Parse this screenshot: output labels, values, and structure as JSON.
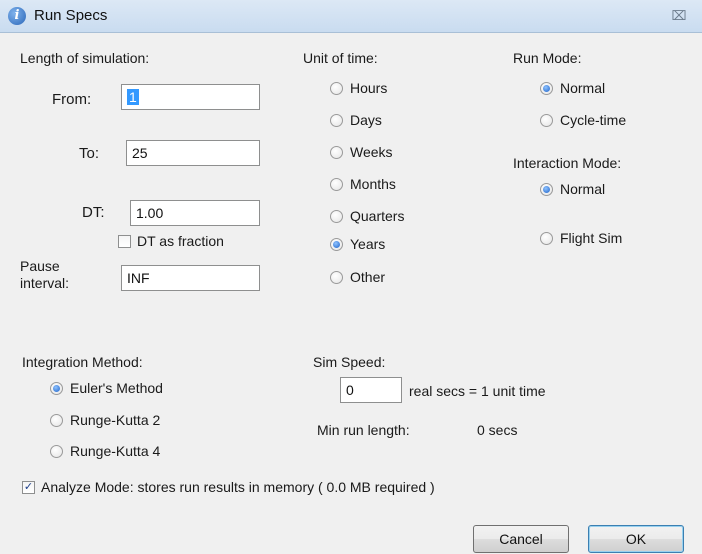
{
  "window": {
    "title": "Run Specs",
    "close_glyph": "⌧"
  },
  "length": {
    "heading": "Length of simulation:",
    "from_label": "From:",
    "from_value": "1",
    "to_label": "To:",
    "to_value": "25",
    "dt_label": "DT:",
    "dt_value": "1.00",
    "dt_fraction_label": "DT as fraction",
    "dt_fraction_checked": false,
    "pause_label_line1": "Pause",
    "pause_label_line2": "interval:",
    "pause_value": "INF"
  },
  "unit_of_time": {
    "heading": "Unit of time:",
    "options": [
      "Hours",
      "Days",
      "Weeks",
      "Months",
      "Quarters",
      "Years",
      "Other"
    ],
    "selected": "Years"
  },
  "run_mode": {
    "heading": "Run Mode:",
    "options": [
      "Normal",
      "Cycle-time"
    ],
    "selected": "Normal"
  },
  "interaction_mode": {
    "heading": "Interaction Mode:",
    "options": [
      "Normal",
      "Flight Sim"
    ],
    "selected": "Normal"
  },
  "integration": {
    "heading": "Integration Method:",
    "options": [
      "Euler's Method",
      "Runge-Kutta 2",
      "Runge-Kutta 4"
    ],
    "selected": "Euler's Method"
  },
  "sim_speed": {
    "heading": "Sim Speed:",
    "value": "0",
    "suffix": "real secs = 1 unit time",
    "min_run_label": "Min run length:",
    "min_run_value": "0 secs"
  },
  "analyze": {
    "label": "Analyze Mode: stores run results in memory ( 0.0 MB required )",
    "checked": true
  },
  "buttons": {
    "cancel": "Cancel",
    "ok": "OK"
  }
}
